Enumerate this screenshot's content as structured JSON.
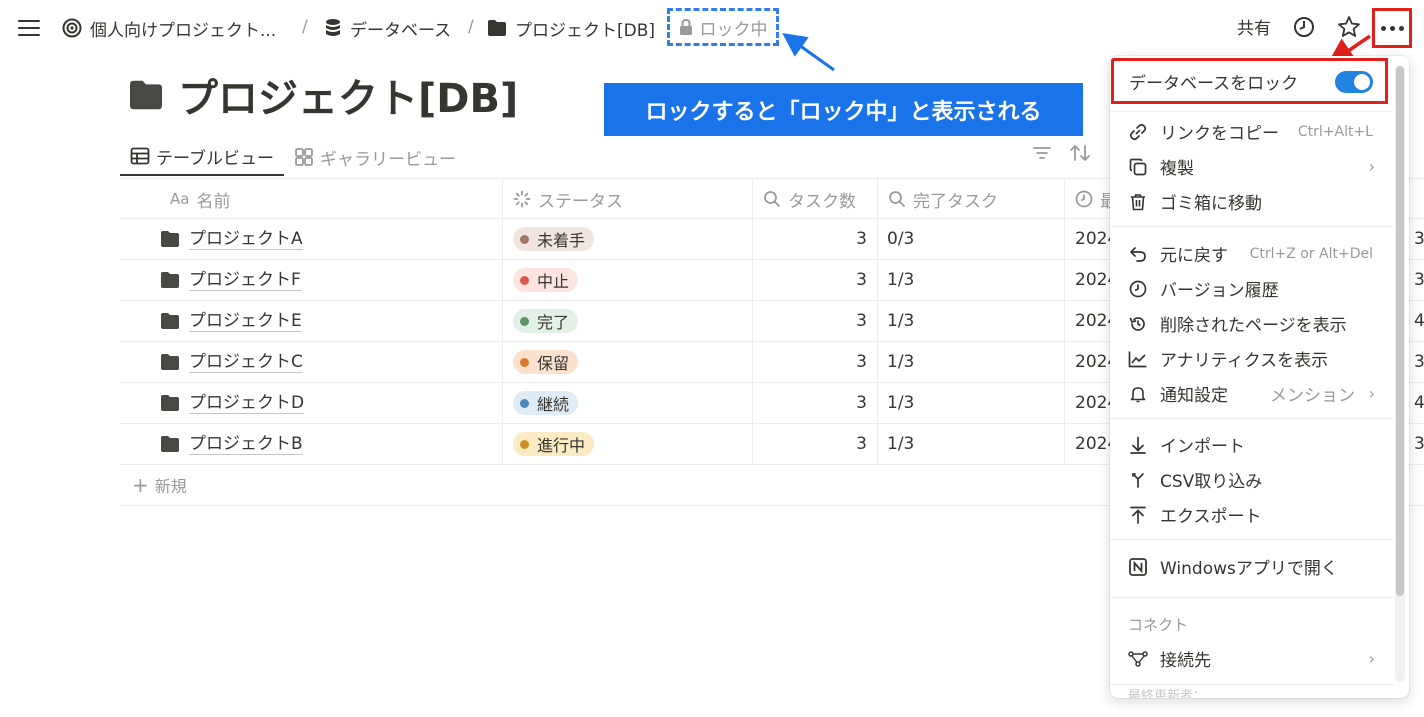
{
  "breadcrumbs": [
    {
      "label": "個人向けプロジェクト..."
    },
    {
      "label": "データベース"
    },
    {
      "label": "プロジェクト[DB]"
    }
  ],
  "breadcrumb_separator": "/",
  "lock_status": "ロック中",
  "topbar": {
    "share": "共有"
  },
  "page_title": "プロジェクト[DB]",
  "views": [
    {
      "label": "テーブルビュー",
      "active": true
    },
    {
      "label": "ギャラリービュー",
      "active": false
    }
  ],
  "table": {
    "columns": [
      {
        "prefix": "Aa",
        "label": "名前"
      },
      {
        "label": "ステータス"
      },
      {
        "label": "タスク数"
      },
      {
        "label": "完了タスク"
      },
      {
        "label": "最"
      }
    ],
    "rows": [
      {
        "name": "プロジェクトA",
        "status": "未着手",
        "tasks": "3",
        "done": "0/3",
        "date": "2024",
        "extra": "3"
      },
      {
        "name": "プロジェクトF",
        "status": "中止",
        "tasks": "3",
        "done": "1/3",
        "date": "2024",
        "extra": "3"
      },
      {
        "name": "プロジェクトE",
        "status": "完了",
        "tasks": "3",
        "done": "1/3",
        "date": "2024",
        "extra": "4"
      },
      {
        "name": "プロジェクトC",
        "status": "保留",
        "tasks": "3",
        "done": "1/3",
        "date": "2024",
        "extra": "3"
      },
      {
        "name": "プロジェクトD",
        "status": "継続",
        "tasks": "3",
        "done": "1/3",
        "date": "2024",
        "extra": "4"
      },
      {
        "name": "プロジェクトB",
        "status": "進行中",
        "tasks": "3",
        "done": "1/3",
        "date": "2024",
        "extra": "3"
      }
    ],
    "new_row": "新規"
  },
  "status_colors": {
    "未着手": {
      "bg": "#f1e5df",
      "dot": "#a27763"
    },
    "中止": {
      "bg": "#fde4e1",
      "dot": "#d9574a"
    },
    "完了": {
      "bg": "#e3f0e6",
      "dot": "#5b9467"
    },
    "保留": {
      "bg": "#fbe2cf",
      "dot": "#d9792e"
    },
    "継続": {
      "bg": "#dfecf6",
      "dot": "#4f86b8"
    },
    "進行中": {
      "bg": "#faebc4",
      "dot": "#c99126"
    }
  },
  "callout": "ロックすると「ロック中」と表示される",
  "menu": {
    "lock_label": "データベースをロック",
    "lock_enabled": true,
    "items": [
      {
        "icon": "link-icon",
        "label": "リンクをコピー",
        "shortcut": "Ctrl+Alt+L"
      },
      {
        "icon": "duplicate-icon",
        "label": "複製",
        "chevron": "›"
      },
      {
        "icon": "trash-icon",
        "label": "ゴミ箱に移動"
      },
      {
        "icon": "undo-icon",
        "label": "元に戻す",
        "shortcut": "Ctrl+Z or Alt+Del"
      },
      {
        "icon": "history-icon",
        "label": "バージョン履歴"
      },
      {
        "icon": "deleted-pages-icon",
        "label": "削除されたページを表示"
      },
      {
        "icon": "analytics-icon",
        "label": "アナリティクスを表示"
      },
      {
        "icon": "bell-icon",
        "label": "通知設定",
        "sub": "メンション",
        "chevron": "›"
      },
      {
        "icon": "import-icon",
        "label": "インポート"
      },
      {
        "icon": "csv-merge-icon",
        "label": "CSV取り込み"
      },
      {
        "icon": "export-icon",
        "label": "エクスポート"
      },
      {
        "icon": "notion-icon",
        "label": "Windowsアプリで開く"
      },
      {
        "icon": "connection-icon",
        "label": "接続先",
        "chevron": "›"
      }
    ],
    "section_label": "コネクト",
    "footer_fade": "最終更新者：...."
  },
  "colors": {
    "accent_blue": "#2383e2",
    "callout_blue": "#1a73e8",
    "highlight_red": "#e0201b"
  }
}
